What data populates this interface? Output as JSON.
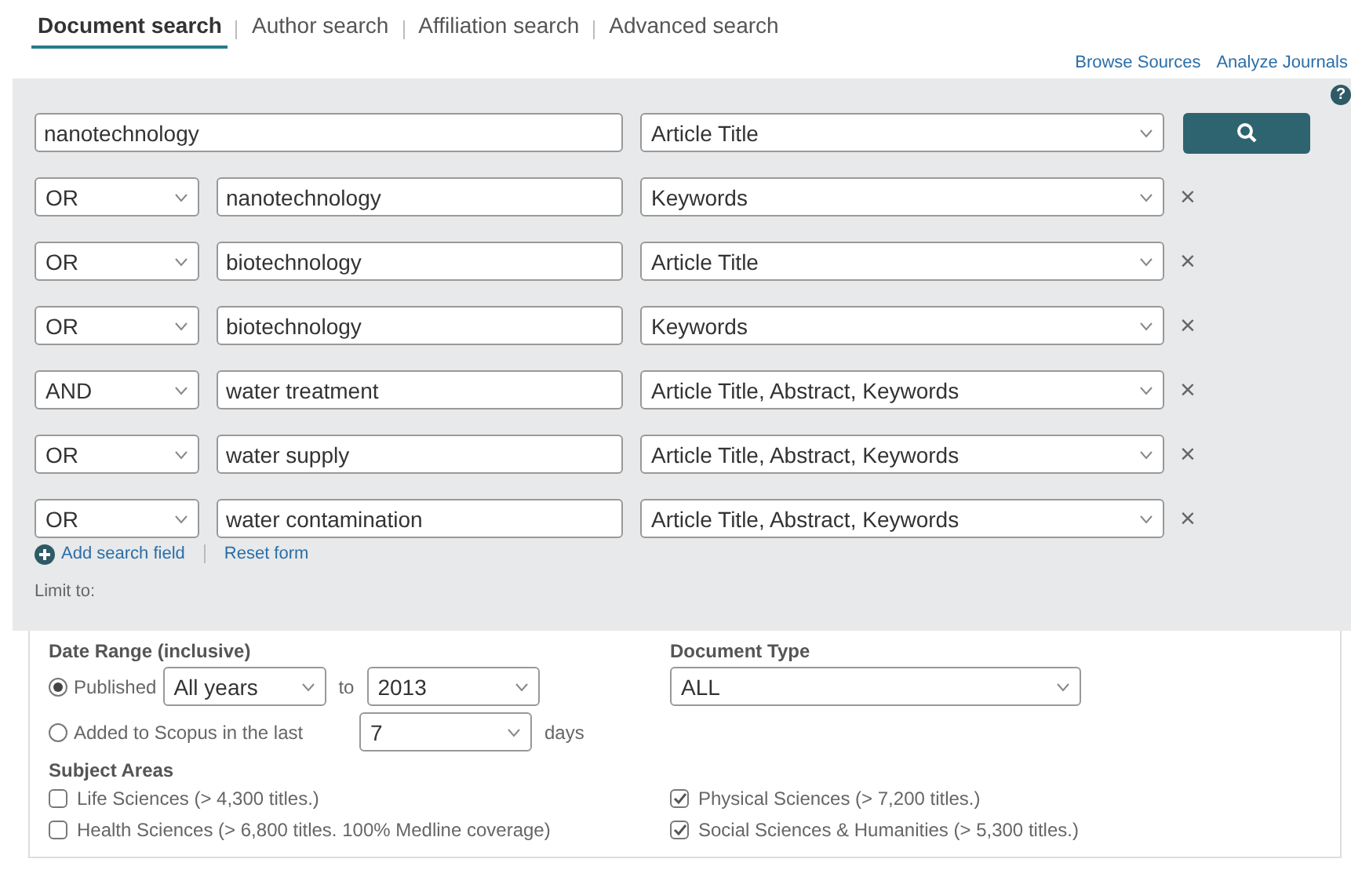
{
  "tabs": [
    {
      "label": "Document search",
      "selected": true
    },
    {
      "label": "Author search",
      "selected": false
    },
    {
      "label": "Affiliation search",
      "selected": false
    },
    {
      "label": "Advanced search",
      "selected": false
    }
  ],
  "links": [
    "Browse Sources",
    "Analyze Journals"
  ],
  "help": "?",
  "rows": [
    {
      "term": "nanotechnology",
      "field": "Article Title"
    },
    {
      "operator": "OR",
      "term": "nanotechnology",
      "field": "Keywords",
      "remove": "×"
    },
    {
      "operator": "OR",
      "term": "biotechnology",
      "field": "Article Title",
      "remove": "×"
    },
    {
      "operator": "OR",
      "term": "biotechnology",
      "field": "Keywords",
      "remove": "×"
    },
    {
      "operator": "AND",
      "term": "water treatment",
      "field": "Article Title, Abstract, Keywords",
      "remove": "×"
    },
    {
      "operator": "OR",
      "term": "water supply",
      "field": "Article Title, Abstract, Keywords",
      "remove": "×"
    },
    {
      "operator": "OR",
      "term": "water contamination",
      "field": "Article Title, Abstract, Keywords",
      "remove": "×"
    }
  ],
  "actions": [
    "Add search field",
    "Reset form"
  ],
  "limit_label": "Limit to:",
  "date_range": {
    "heading": "Date Range (inclusive)",
    "published": {
      "label": "Published",
      "selected": true,
      "from": "All years",
      "to_label": "to",
      "to": "2013"
    },
    "added": {
      "label": "Added to Scopus in the last",
      "selected": false,
      "value": "7",
      "unit": "days"
    }
  },
  "document_type": {
    "heading": "Document Type",
    "value": "ALL"
  },
  "subject_areas": {
    "heading": "Subject Areas",
    "items": [
      {
        "label": "Life Sciences (> 4,300 titles.)",
        "checked": false
      },
      {
        "label": "Health Sciences (> 6,800 titles. 100% Medline coverage)",
        "checked": false
      },
      {
        "label": "Physical Sciences (> 7,200 titles.)",
        "checked": true
      },
      {
        "label": "Social Sciences & Humanities (> 5,300 titles.)",
        "checked": true
      }
    ]
  }
}
